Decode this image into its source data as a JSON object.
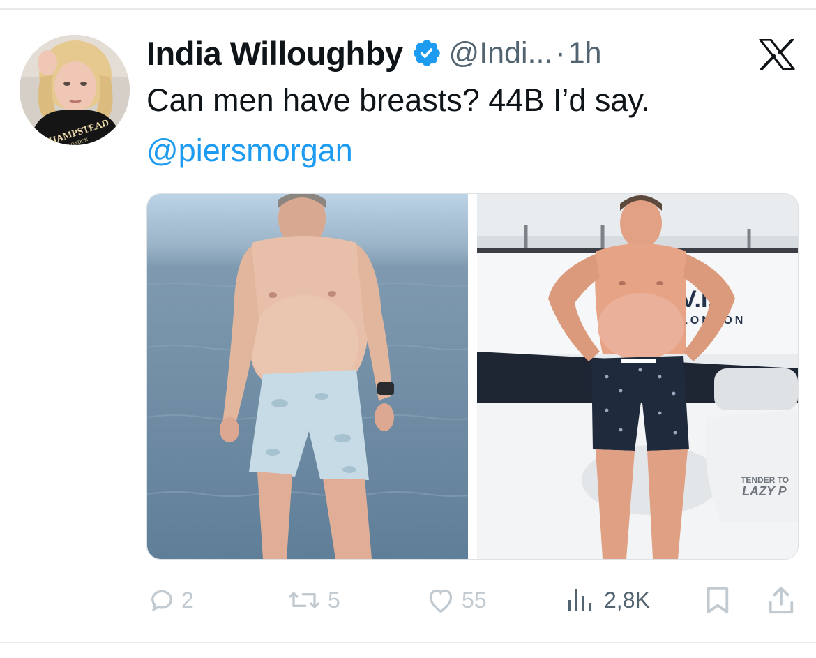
{
  "tweet": {
    "author_name": "India Willoughby",
    "handle": "@Indi...",
    "separator": "·",
    "time": "1h",
    "text": "Can men have breasts? 44B I’d say.",
    "mention": "@piersmorgan"
  },
  "avatar": {
    "shirt_text": "HAMPSTEAD",
    "shirt_subtext": "LONDON"
  },
  "media": {
    "right_photo_texts": [
      "V.I.P",
      "LONDON",
      "TENDER TO",
      "LAZY P"
    ]
  },
  "actions": {
    "replies": "2",
    "retweets": "5",
    "likes": "55",
    "views": "2,8K"
  },
  "colors": {
    "verified": "#1d9bf0",
    "link": "#1d9bf0",
    "muted": "#536471",
    "action_gray": "#8b98a5"
  },
  "icons": [
    "verified-badge-icon",
    "x-logo-icon",
    "reply-icon",
    "retweet-icon",
    "like-icon",
    "views-icon",
    "bookmark-icon",
    "share-icon"
  ]
}
